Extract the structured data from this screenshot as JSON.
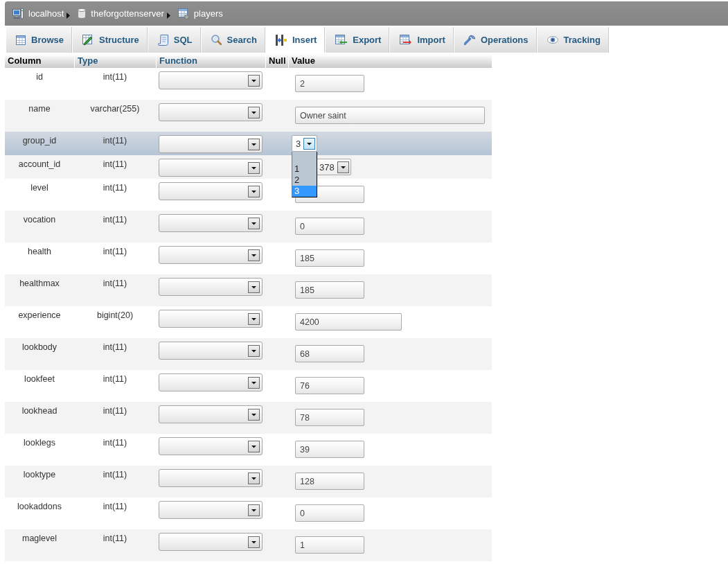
{
  "breadcrumb": [
    {
      "label": "localhost"
    },
    {
      "label": "theforgottenserver"
    },
    {
      "label": "players"
    }
  ],
  "tabs": [
    {
      "label": "Browse",
      "selected": false
    },
    {
      "label": "Structure",
      "selected": false
    },
    {
      "label": "SQL",
      "selected": false
    },
    {
      "label": "Search",
      "selected": false
    },
    {
      "label": "Insert",
      "selected": true
    },
    {
      "label": "Export",
      "selected": false
    },
    {
      "label": "Import",
      "selected": false
    },
    {
      "label": "Operations",
      "selected": false
    },
    {
      "label": "Tracking",
      "selected": false
    }
  ],
  "table": {
    "columns": [
      {
        "label": "Column",
        "link": false
      },
      {
        "label": "Type",
        "link": true
      },
      {
        "label": "Function",
        "link": true
      },
      {
        "label": "Null",
        "link": false
      },
      {
        "label": "Value",
        "link": false
      }
    ],
    "rows": [
      {
        "column": "id",
        "type": "int(11)",
        "kind": "int",
        "value": "2",
        "highlighted": false
      },
      {
        "column": "name",
        "type": "varchar(255)",
        "kind": "text",
        "value": "Owner saint",
        "highlighted": false
      },
      {
        "column": "group_id",
        "type": "int(11)",
        "kind": "select",
        "value": "3",
        "expanded": true,
        "highlighted": true,
        "options": [
          {
            "label": "1",
            "selected": false
          },
          {
            "label": "2",
            "selected": false
          },
          {
            "label": "3",
            "selected": true
          }
        ]
      },
      {
        "column": "account_id",
        "type": "int(11)",
        "kind": "select",
        "value": "378",
        "expanded": false,
        "highlighted": false
      },
      {
        "column": "level",
        "type": "int(11)",
        "kind": "int",
        "highlighted": false
      },
      {
        "column": "vocation",
        "type": "int(11)",
        "kind": "int",
        "value": "0",
        "highlighted": false
      },
      {
        "column": "health",
        "type": "int(11)",
        "kind": "int",
        "value": "185",
        "highlighted": false
      },
      {
        "column": "healthmax",
        "type": "int(11)",
        "kind": "int",
        "value": "185",
        "highlighted": false
      },
      {
        "column": "experience",
        "type": "bigint(20)",
        "kind": "bigint",
        "value": "4200",
        "highlighted": false
      },
      {
        "column": "lookbody",
        "type": "int(11)",
        "kind": "int",
        "value": "68",
        "highlighted": false
      },
      {
        "column": "lookfeet",
        "type": "int(11)",
        "kind": "int",
        "value": "76",
        "highlighted": false
      },
      {
        "column": "lookhead",
        "type": "int(11)",
        "kind": "int",
        "value": "78",
        "highlighted": false
      },
      {
        "column": "looklegs",
        "type": "int(11)",
        "kind": "int",
        "value": "39",
        "highlighted": false
      },
      {
        "column": "looktype",
        "type": "int(11)",
        "kind": "int",
        "value": "128",
        "highlighted": false
      },
      {
        "column": "lookaddons",
        "type": "int(11)",
        "kind": "int",
        "value": "0",
        "highlighted": false
      },
      {
        "column": "maglevel",
        "type": "int(11)",
        "kind": "int",
        "value": "1",
        "highlighted": false
      }
    ]
  }
}
